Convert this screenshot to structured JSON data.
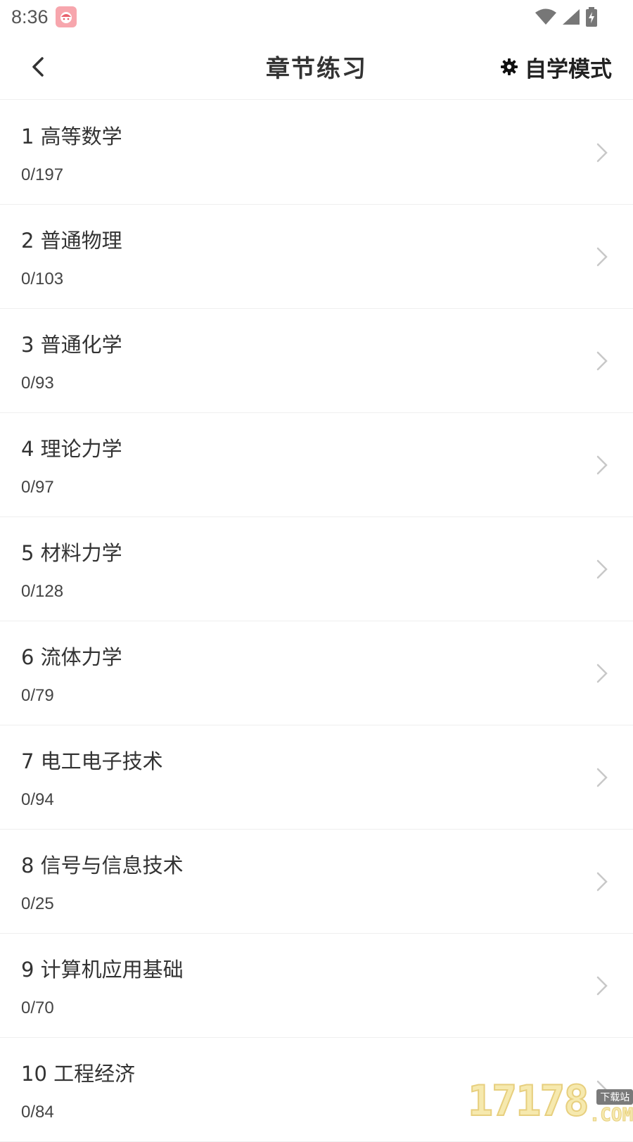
{
  "status_bar": {
    "time": "8:36",
    "icons": [
      "app-notification-icon",
      "wifi-icon",
      "signal-icon",
      "battery-icon"
    ]
  },
  "header": {
    "title": "章节练习",
    "mode_label": "自学模式",
    "icons": [
      "back-arrow-icon",
      "gear-icon"
    ]
  },
  "chapters": [
    {
      "name": "1 高等数学",
      "progress": "0/197"
    },
    {
      "name": "2 普通物理",
      "progress": "0/103"
    },
    {
      "name": "3 普通化学",
      "progress": "0/93"
    },
    {
      "name": "4 理论力学",
      "progress": "0/97"
    },
    {
      "name": "5 材料力学",
      "progress": "0/128"
    },
    {
      "name": "6 流体力学",
      "progress": "0/79"
    },
    {
      "name": "7 电工电子技术",
      "progress": "0/94"
    },
    {
      "name": "8 信号与信息技术",
      "progress": "0/25"
    },
    {
      "name": "9 计算机应用基础",
      "progress": "0/70"
    },
    {
      "name": "10 工程经济",
      "progress": "0/84"
    }
  ],
  "watermark": {
    "number": "17178",
    "tag": "下载站",
    "suffix": ".COM"
  },
  "colors": {
    "text_primary": "#333333",
    "divider": "#efefef",
    "chevron": "#c8c8c8",
    "badge": "#f7a6ad"
  }
}
